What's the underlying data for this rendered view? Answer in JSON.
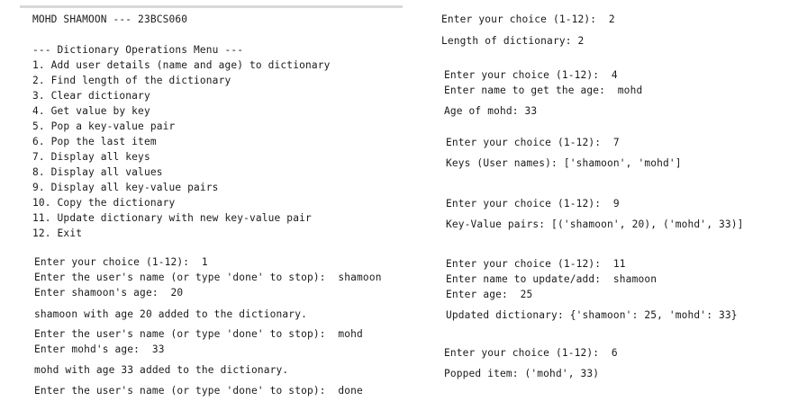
{
  "header": "MOHD SHAMOON --- 23BCS060",
  "menu": {
    "title": "--- Dictionary Operations Menu ---",
    "items": [
      "1. Add user details (name and age) to dictionary",
      "2. Find length of the dictionary",
      "3. Clear dictionary",
      "4. Get value by key",
      "5. Pop a key-value pair",
      "6. Pop the last item",
      "7. Display all keys",
      "8. Display all values",
      "9. Display all key-value pairs",
      "10. Copy the dictionary",
      "11. Update dictionary with new key-value pair",
      "12. Exit"
    ]
  },
  "left_session": [
    "Enter your choice (1-12):  1",
    "Enter the user's name (or type 'done' to stop):  shamoon",
    "Enter shamoon's age:  20",
    "shamoon with age 20 added to the dictionary.",
    "Enter the user's name (or type 'done' to stop):  mohd",
    "Enter mohd's age:  33",
    "mohd with age 33 added to the dictionary.",
    "Enter the user's name (or type 'done' to stop):  done"
  ],
  "right_session": [
    "Enter your choice (1-12):  2",
    "Length of dictionary: 2",
    "Enter your choice (1-12):  4",
    "Enter name to get the age:  mohd",
    "Age of mohd: 33",
    "Enter your choice (1-12):  7",
    "Keys (User names): ['shamoon', 'mohd']",
    "Enter your choice (1-12):  9",
    "Key-Value pairs: [('shamoon', 20), ('mohd', 33)]",
    "Enter your choice (1-12):  11",
    "Enter name to update/add:  shamoon",
    "Enter age:  25",
    "Updated dictionary: {'shamoon': 25, 'mohd': 33}",
    "Enter your choice (1-12):  6",
    "Popped item: ('mohd', 33)"
  ]
}
